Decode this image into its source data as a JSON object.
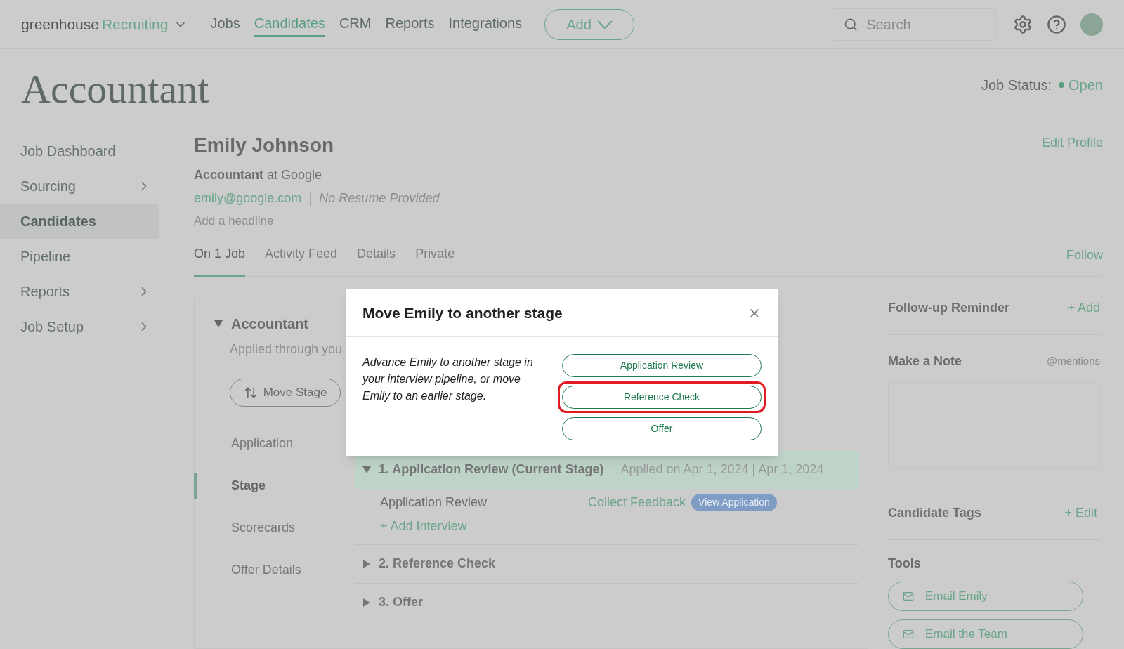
{
  "nav": {
    "brand": "greenhouse",
    "product": "Recruiting",
    "links": [
      {
        "label": "Jobs",
        "selected": false
      },
      {
        "label": "Candidates",
        "selected": true
      },
      {
        "label": "CRM",
        "selected": false
      },
      {
        "label": "Reports",
        "selected": false
      },
      {
        "label": "Integrations",
        "selected": false
      }
    ],
    "add_button": "Add",
    "search": {
      "placeholder": "Search"
    }
  },
  "page_title": "Accountant",
  "job_status": {
    "label": "Job Status:",
    "value": "Open",
    "color": "#5a9e80"
  },
  "sidebar": {
    "items": [
      {
        "label": "Job Dashboard",
        "selected": false,
        "expandable": false
      },
      {
        "label": "Sourcing",
        "selected": false,
        "expandable": true
      },
      {
        "label": "Candidates",
        "selected": true,
        "expandable": false
      },
      {
        "label": "Pipeline",
        "selected": false,
        "expandable": false
      },
      {
        "label": "Reports",
        "selected": false,
        "expandable": true
      },
      {
        "label": "Job Setup",
        "selected": false,
        "expandable": true
      }
    ]
  },
  "candidate": {
    "name": "Emily Johnson",
    "title_role": "Accountant",
    "title_rest": " at Google",
    "email": "emily@google.com",
    "resume": "No Resume Provided",
    "headline_placeholder": "Add a headline",
    "edit_profile": "Edit Profile"
  },
  "tabs": [
    {
      "label": "On 1 Job",
      "selected": true
    },
    {
      "label": "Activity Feed",
      "selected": false
    },
    {
      "label": "Details",
      "selected": false
    },
    {
      "label": "Private",
      "selected": false
    }
  ],
  "follow": "Follow",
  "job_card": {
    "title": "Accountant",
    "applied": "Applied through you",
    "move_stage": "Move Stage",
    "sections": [
      {
        "label": "Application",
        "selected": false
      },
      {
        "label": "Stage",
        "selected": true
      },
      {
        "label": "Scorecards",
        "selected": false
      },
      {
        "label": "Offer Details",
        "selected": false
      }
    ],
    "stages": [
      {
        "number": "1.",
        "name": "Application Review (Current Stage)",
        "date": "Applied on Apr 1, 2024 | Apr 1, 2024",
        "expanded": true,
        "current": true,
        "interviews": [
          {
            "name": "Application Review",
            "feedback": "Collect Feedback",
            "badge": "View Application"
          }
        ],
        "add_interview": "+ Add Interview"
      },
      {
        "number": "2.",
        "name": "Reference Check",
        "expanded": false,
        "current": false
      },
      {
        "number": "3.",
        "name": "Offer",
        "expanded": false,
        "current": false
      }
    ]
  },
  "right_panel": {
    "reminder": {
      "title": "Follow-up Reminder",
      "action": "+ Add"
    },
    "note": {
      "title": "Make a Note",
      "hint": "@mentions"
    },
    "tags": {
      "title": "Candidate Tags",
      "action": "+ Edit"
    },
    "tools": {
      "title": "Tools",
      "buttons": [
        "Email Emily",
        "Email the Team"
      ]
    }
  },
  "modal": {
    "title": "Move Emily to another stage",
    "description": "Advance Emily to another stage in your interview pipeline, or move Emily to an earlier stage.",
    "options": [
      {
        "label": "Application Review",
        "selected": false
      },
      {
        "label": "Reference Check",
        "selected": true
      },
      {
        "label": "Offer",
        "selected": false
      }
    ]
  }
}
